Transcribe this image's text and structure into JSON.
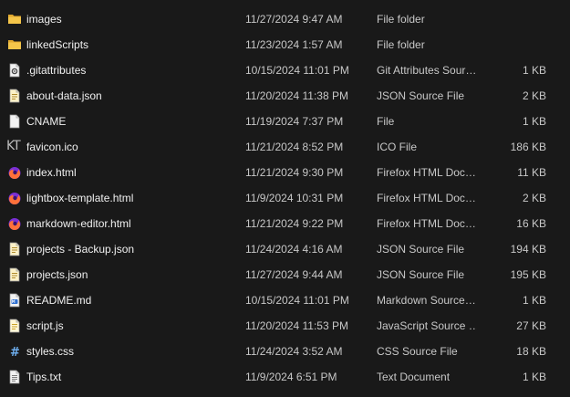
{
  "files": [
    {
      "name": "images",
      "date": "11/27/2024 9:47 AM",
      "type": "File folder",
      "size": "",
      "icon": "folder-icon"
    },
    {
      "name": "linkedScripts",
      "date": "11/23/2024 1:57 AM",
      "type": "File folder",
      "size": "",
      "icon": "folder-icon"
    },
    {
      "name": ".gitattributes",
      "date": "10/15/2024 11:01 PM",
      "type": "Git Attributes Sour…",
      "size": "1 KB",
      "icon": "gear-file-icon"
    },
    {
      "name": "about-data.json",
      "date": "11/20/2024 11:38 PM",
      "type": "JSON Source File",
      "size": "2 KB",
      "icon": "json-file-icon"
    },
    {
      "name": "CNAME",
      "date": "11/19/2024 7:37 PM",
      "type": "File",
      "size": "1 KB",
      "icon": "blank-file-icon"
    },
    {
      "name": "favicon.ico",
      "date": "11/21/2024 8:52 PM",
      "type": "ICO File",
      "size": "186 KB",
      "icon": "favicon-icon",
      "glyph": "KT"
    },
    {
      "name": "index.html",
      "date": "11/21/2024 9:30 PM",
      "type": "Firefox HTML Doc…",
      "size": "11 KB",
      "icon": "firefox-icon"
    },
    {
      "name": "lightbox-template.html",
      "date": "11/9/2024 10:31 PM",
      "type": "Firefox HTML Doc…",
      "size": "2 KB",
      "icon": "firefox-icon"
    },
    {
      "name": "markdown-editor.html",
      "date": "11/21/2024 9:22 PM",
      "type": "Firefox HTML Doc…",
      "size": "16 KB",
      "icon": "firefox-icon"
    },
    {
      "name": "projects - Backup.json",
      "date": "11/24/2024 4:16 AM",
      "type": "JSON Source File",
      "size": "194 KB",
      "icon": "json-file-icon"
    },
    {
      "name": "projects.json",
      "date": "11/27/2024 9:44 AM",
      "type": "JSON Source File",
      "size": "195 KB",
      "icon": "json-file-icon"
    },
    {
      "name": "README.md",
      "date": "10/15/2024 11:01 PM",
      "type": "Markdown Source…",
      "size": "1 KB",
      "icon": "markdown-file-icon"
    },
    {
      "name": "script.js",
      "date": "11/20/2024 11:53 PM",
      "type": "JavaScript Source …",
      "size": "27 KB",
      "icon": "js-file-icon"
    },
    {
      "name": "styles.css",
      "date": "11/24/2024 3:52 AM",
      "type": "CSS Source File",
      "size": "18 KB",
      "icon": "css-file-icon"
    },
    {
      "name": "Tips.txt",
      "date": "11/9/2024 6:51 PM",
      "type": "Text Document",
      "size": "1 KB",
      "icon": "text-file-icon"
    }
  ],
  "colors": {
    "background": "#191919",
    "folder": "#f4c54a",
    "firefox_orange": "#ff7139",
    "firefox_purple": "#7a2fd6"
  }
}
